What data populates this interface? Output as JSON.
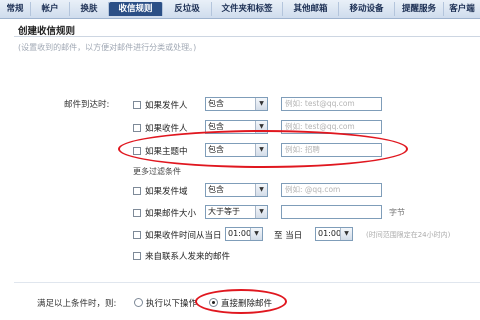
{
  "tabs": [
    {
      "label": "常规"
    },
    {
      "label": "帐户"
    },
    {
      "label": "换肤"
    },
    {
      "label": "收信规则",
      "active": true
    },
    {
      "label": "反垃圾"
    },
    {
      "label": "文件夹和标签"
    },
    {
      "label": "其他邮箱"
    },
    {
      "label": "移动设备"
    },
    {
      "label": "提醒服务"
    },
    {
      "label": "客户端"
    }
  ],
  "page_title": "创建收信规则",
  "hint": "(设置收到的邮件，以方便对邮件进行分类或处理。)",
  "arrival_label": "邮件到达时:",
  "conditions": [
    {
      "label": "如果发件人",
      "op": "包含",
      "placeholder": "例如: test@qq.com"
    },
    {
      "label": "如果收件人",
      "op": "包含",
      "placeholder": "例如: test@qq.com"
    },
    {
      "label": "如果主题中",
      "op": "包含",
      "placeholder": "例如: 招聘"
    }
  ],
  "more_conditions_label": "更多过滤条件",
  "more_conditions": [
    {
      "label": "如果发件域",
      "op": "包含",
      "placeholder": "例如: @qq.com"
    },
    {
      "label": "如果邮件大小",
      "op": "大于等于",
      "unit": "字节"
    },
    {
      "label": "如果收件时间从当日",
      "from": "01:00",
      "to_label": "至  当日",
      "to": "01:00",
      "note": "(时间范围限定在24小时内)"
    },
    {
      "label": "来自联系人发来的邮件"
    }
  ],
  "satisfy_label": "满足以上条件时，则:",
  "actions": [
    {
      "label": "执行以下操作",
      "checked": false
    },
    {
      "label": "直接删除邮件",
      "checked": true
    }
  ],
  "accent_color": "#2b4f86",
  "annotation_color": "#e0171f"
}
